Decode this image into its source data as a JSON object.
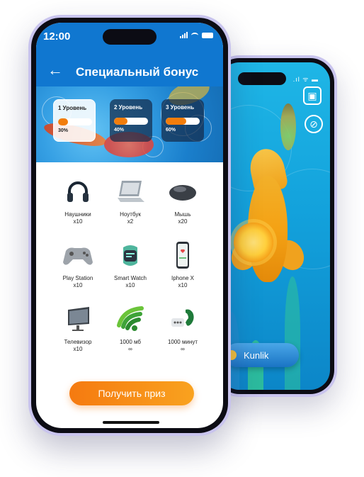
{
  "back_screen": {
    "status": ".ıl ᯤ ▬",
    "button_label": "Kunlik"
  },
  "front_screen": {
    "time": "12:00",
    "title": "Специальный бонус",
    "levels": [
      {
        "label": "1 Уровень",
        "percent_text": "30%",
        "progress": 0.3
      },
      {
        "label": "2 Уровень",
        "percent_text": "40%",
        "progress": 0.4
      },
      {
        "label": "3 Уровень",
        "percent_text": "60%",
        "progress": 0.6
      }
    ],
    "prizes": [
      {
        "name": "Наушники",
        "qty": "x10",
        "icon": "headphones-icon"
      },
      {
        "name": "Ноутбук",
        "qty": "x2",
        "icon": "laptop-icon"
      },
      {
        "name": "Мышь",
        "qty": "x20",
        "icon": "mouse-icon"
      },
      {
        "name": "Play Station",
        "qty": "x10",
        "icon": "gamepad-icon"
      },
      {
        "name": "Smart Watch",
        "qty": "x10",
        "icon": "smartwatch-icon"
      },
      {
        "name": "Iphone X",
        "qty": "x10",
        "icon": "smartphone-icon"
      },
      {
        "name": "Телевизор",
        "qty": "x10",
        "icon": "tv-icon"
      },
      {
        "name": "1000 мб",
        "qty": "∞",
        "icon": "wifi-icon"
      },
      {
        "name": "1000 минут",
        "qty": "∞",
        "icon": "phone-call-icon"
      }
    ],
    "cta_label": "Получить приз"
  },
  "colors": {
    "header_blue": "#1077d0",
    "accent_orange": "#f27d0c",
    "frame_lavender": "#c9c4ee"
  }
}
